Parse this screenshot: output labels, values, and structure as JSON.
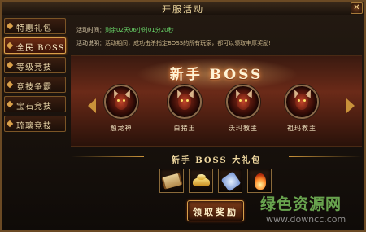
{
  "window": {
    "title": "开服活动",
    "close_glyph": "✕"
  },
  "sidebar": {
    "items": [
      {
        "label": "特惠礼包",
        "active": false
      },
      {
        "label": "全民 BOSS",
        "active": true
      },
      {
        "label": "等级竞技",
        "active": false
      },
      {
        "label": "竞技争霸",
        "active": false
      },
      {
        "label": "宝石竞技",
        "active": false
      },
      {
        "label": "琉璃竞技",
        "active": false
      }
    ]
  },
  "activity": {
    "time_label": "活动时间：",
    "time_value": "剩余02天06小时01分20秒",
    "desc_label": "活动说明：",
    "desc_value": "活动期间，成功击杀指定BOSS的所有玩家，都可以领取丰厚奖励!"
  },
  "banner": {
    "title": "新手 BOSS",
    "bosses": [
      {
        "name": "触龙神",
        "icon": "dragon-boss-icon"
      },
      {
        "name": "白猪王",
        "icon": "pig-boss-icon"
      },
      {
        "name": "沃玛教主",
        "icon": "woma-boss-icon"
      },
      {
        "name": "祖玛教主",
        "icon": "zuma-boss-icon"
      }
    ]
  },
  "gift": {
    "title": "新手 BOSS 大礼包",
    "items": [
      {
        "icon": "scroll-icon"
      },
      {
        "icon": "gold-ingot-icon"
      },
      {
        "icon": "potion-bottle-icon"
      },
      {
        "icon": "flame-icon"
      }
    ],
    "claim_label": "领取奖励"
  },
  "watermark": {
    "text": "绿色资源网",
    "url": "www.downcc.com"
  },
  "colors": {
    "accent_gold": "#d9a04a",
    "active_tab": "#6a2a12",
    "time_green": "#6ad86a"
  }
}
